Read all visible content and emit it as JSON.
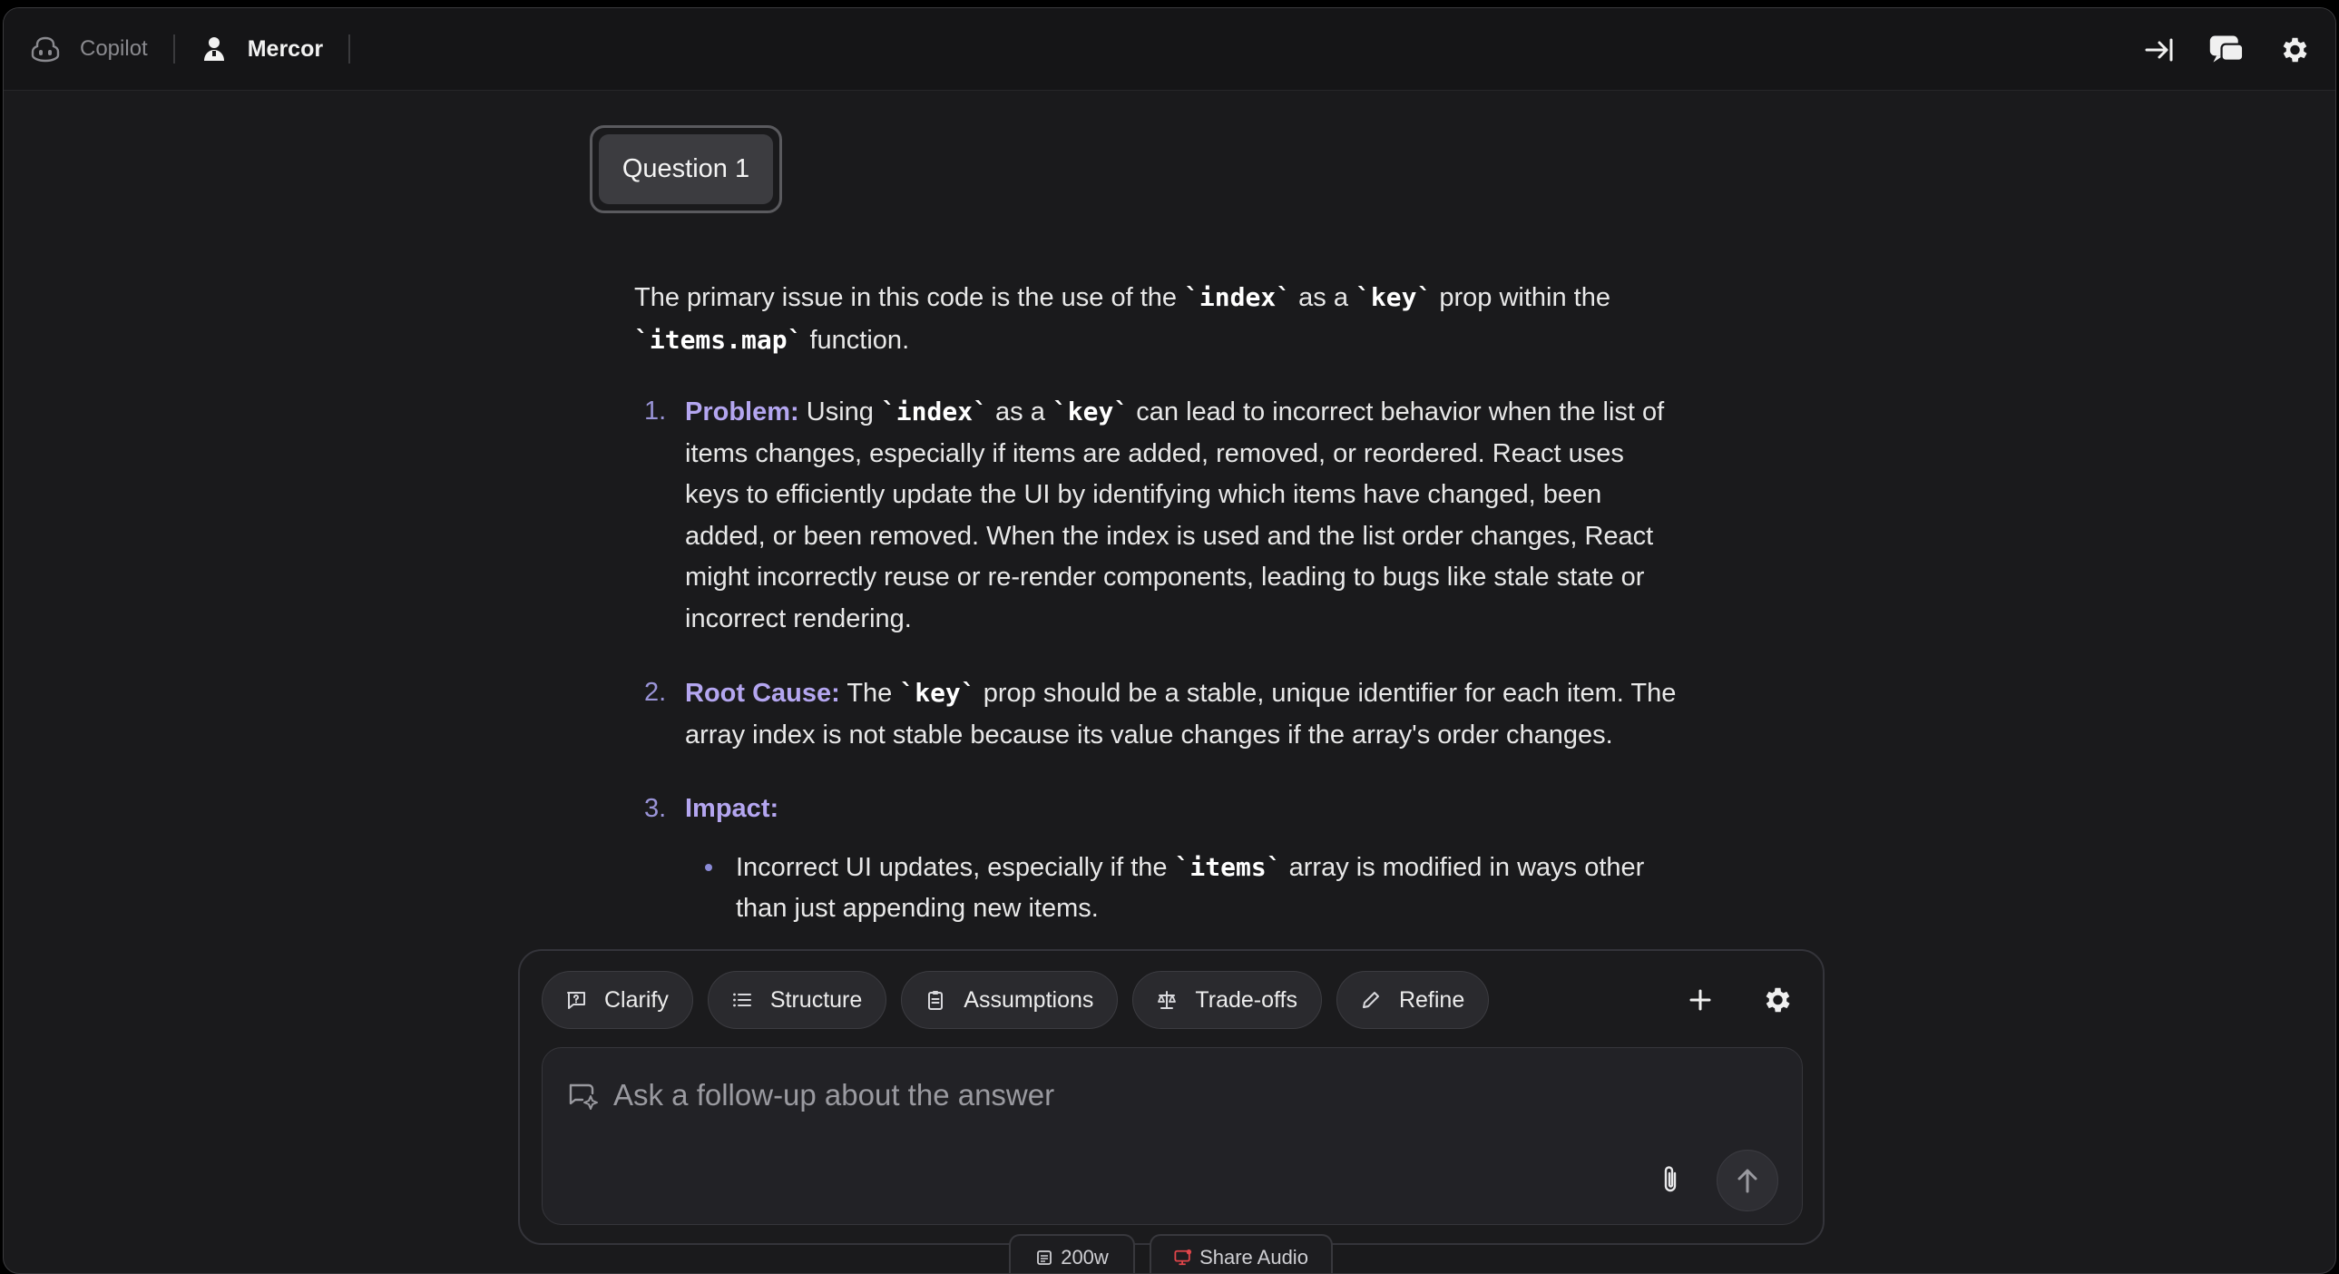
{
  "topbar": {
    "app_name": "Copilot",
    "workspace": "Mercor",
    "icons": [
      "copilot-icon",
      "person-icon",
      "collapse-panel-icon",
      "chat-icon",
      "gear-icon"
    ]
  },
  "question": {
    "label": "Question 1"
  },
  "answer": {
    "intro": {
      "t1": "The primary issue in this code is the use of the ",
      "c1": "`index`",
      "t2": " as a ",
      "c2": "`key`",
      "t3": " prop within the ",
      "c3": "`items.map`",
      "t4": " function."
    },
    "items": [
      {
        "num": "1.",
        "head": "Problem:",
        "t1": " Using ",
        "c1": "`index`",
        "t2": " as a ",
        "c2": "`key`",
        "t3": " can lead to incorrect behavior when the list of items changes, especially if items are added, removed, or reordered. React uses keys to efficiently update the UI by identifying which items have changed, been added, or been removed. When the index is used and the list order changes, React might incorrectly reuse or re-render components, leading to bugs like stale state or incorrect rendering."
      },
      {
        "num": "2.",
        "head": "Root Cause:",
        "t1": " The ",
        "c1": "`key`",
        "t2": " prop should be a stable, unique identifier for each item. The array index is not stable because its value changes if the array's order changes."
      },
      {
        "num": "3.",
        "head": "Impact:",
        "bullet": {
          "t1": "Incorrect UI updates, especially if the ",
          "c1": "`items`",
          "t2": " array is modified in ways other than just appending new items."
        }
      }
    ]
  },
  "composer": {
    "chips": [
      {
        "label": "Clarify",
        "icon": "clarify-icon"
      },
      {
        "label": "Structure",
        "icon": "list-icon"
      },
      {
        "label": "Assumptions",
        "icon": "clipboard-icon"
      },
      {
        "label": "Trade-offs",
        "icon": "scale-icon"
      },
      {
        "label": "Refine",
        "icon": "pencil-icon"
      }
    ],
    "placeholder": "Ask a follow-up about the answer"
  },
  "footer": {
    "word_count": "200w",
    "share_audio": "Share Audio"
  },
  "colors": {
    "accent_heading": "#b4a6f0",
    "share_audio_icon": "#e0454a"
  }
}
